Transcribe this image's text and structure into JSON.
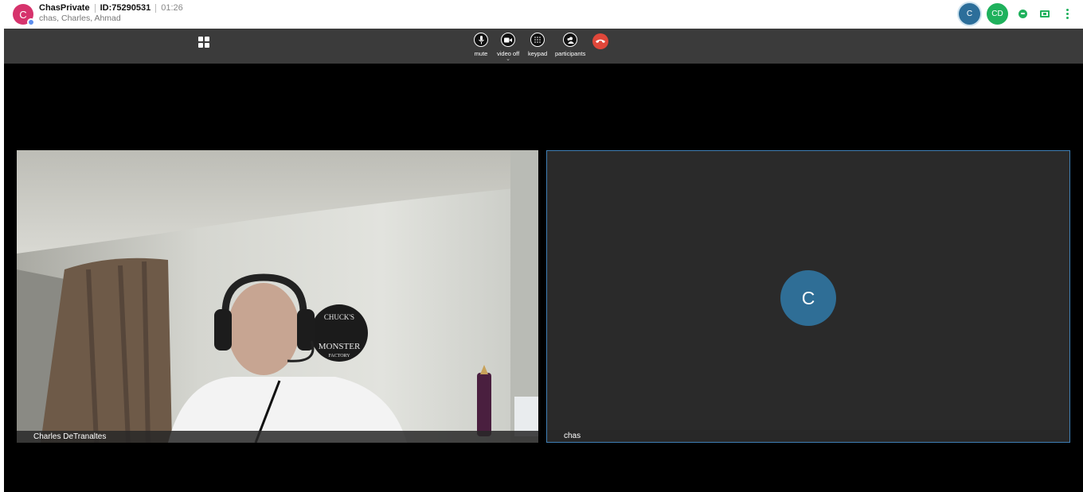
{
  "header": {
    "avatar_initial": "C",
    "meeting_name": "ChasPrivate",
    "meeting_id": "ID:75290531",
    "elapsed": "01:26",
    "participants_line": "chas, Charles, Ahmad",
    "right": {
      "avatar_c": "C",
      "avatar_cd": "CD",
      "chat_icon": "chat-icon",
      "screen_icon": "share-screen-icon",
      "more_icon": "more-vertical-icon"
    }
  },
  "toolbar": {
    "mute_label": "mute",
    "video_label": "video off",
    "keypad_label": "keypad",
    "participants_label": "participants"
  },
  "tiles": {
    "left_name": "Charles DeTranaltes",
    "right_name": "chas",
    "right_initial": "C",
    "poster_lines": [
      "CHUCK'S",
      "MONSTER",
      "FACTORY"
    ]
  },
  "colors": {
    "accent_blue": "#2f6e96",
    "green": "#1fb15c",
    "hangup_red": "#e0473a",
    "header_avatar": "#d6336c"
  }
}
